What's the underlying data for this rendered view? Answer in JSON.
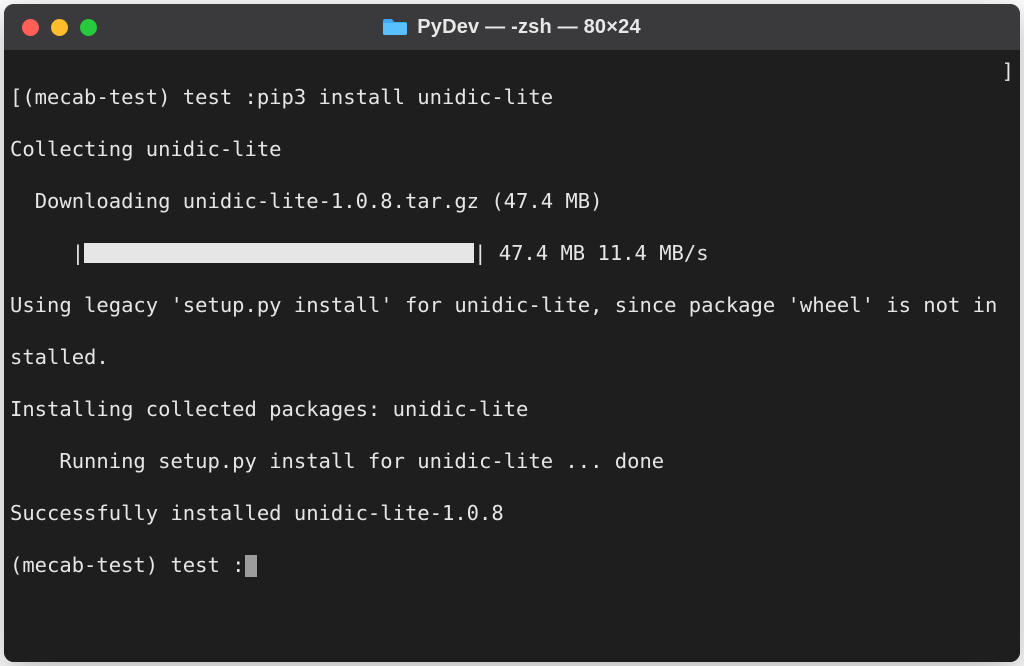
{
  "window": {
    "title": "PyDev — -zsh — 80×24"
  },
  "terminal": {
    "open_bracket": "[",
    "close_bracket": "]",
    "prompt1": "(mecab-test) test :",
    "command1": "pip3 install unidic-lite",
    "line_collecting": "Collecting unidic-lite",
    "line_downloading": "  Downloading unidic-lite-1.0.8.tar.gz (47.4 MB)",
    "progress_prefix": "     |",
    "progress_suffix": "| 47.4 MB 11.4 MB/s",
    "line_legacy1": "Using legacy 'setup.py install' for unidic-lite, since package 'wheel' is not in",
    "line_legacy2": "stalled.",
    "line_installing": "Installing collected packages: unidic-lite",
    "line_running": "    Running setup.py install for unidic-lite ... done",
    "line_success": "Successfully installed unidic-lite-1.0.8",
    "prompt2": "(mecab-test) test :"
  }
}
